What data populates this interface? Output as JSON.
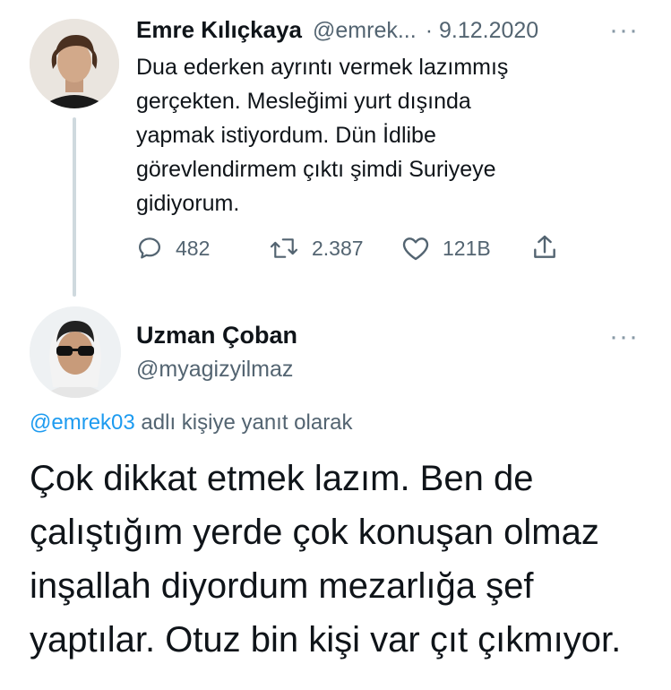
{
  "tweet": {
    "author_name": "Emre Kılıçkaya",
    "author_handle": "@emrek...",
    "date": "· 9.12.2020",
    "more": "···",
    "text": "Dua ederken ayrıntı vermek lazımmış\ngerçekten. Mesleğimi yurt dışında\nyapmak istiyordum. Dün İdlibe\ngörevlendirmem çıktı şimdi Suriyeye\ngidiyorum.",
    "actions": {
      "reply_count": "482",
      "retweet_count": "2.387",
      "like_count": "121B"
    }
  },
  "reply": {
    "author_name": "Uzman Çoban",
    "author_handle": "@myagizyilmaz",
    "more": "···",
    "replying_to_handle": "@emrek03",
    "replying_to_suffix": "adlı kişiye yanıt olarak",
    "text": "Çok dikkat etmek lazım. Ben de\nçalıştığım yerde çok konuşan olmaz\ninşallah diyordum mezarlığa şef\nyaptılar. Otuz bin kişi var çıt çıkmıyor."
  },
  "colors": {
    "link": "#1d9bf0",
    "muted": "#536471",
    "thread_line": "#cfd9de"
  }
}
